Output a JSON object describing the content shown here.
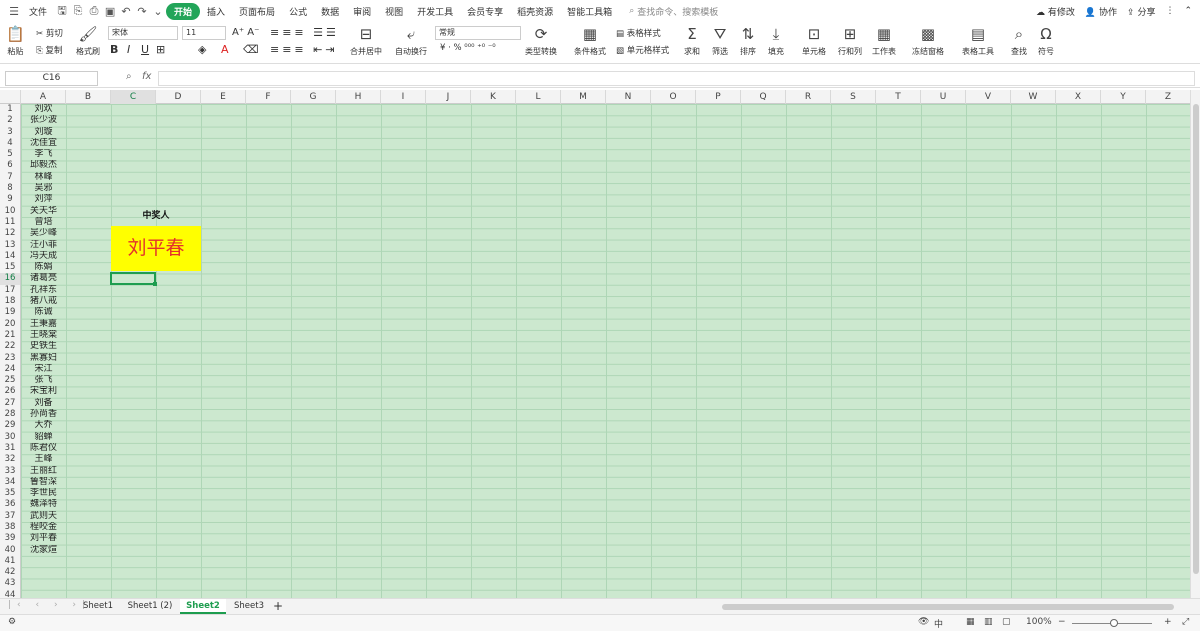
{
  "menubar": {
    "file": "文件",
    "tabs": [
      "开始",
      "插入",
      "页面布局",
      "公式",
      "数据",
      "审阅",
      "视图",
      "开发工具",
      "会员专享",
      "稻壳资源",
      "智能工具箱"
    ],
    "search_placeholder": "查找命令、搜索模板",
    "right": {
      "modified": "有修改",
      "collab": "协作",
      "share": "分享"
    }
  },
  "ribbon": {
    "paste": "粘贴",
    "cut": "剪切",
    "copy": "复制",
    "format_painter": "格式刷",
    "font_name": "宋体",
    "font_size": "11",
    "merge_center": "合并居中",
    "wrap_text": "自动换行",
    "number_format": "常规",
    "type_convert": "类型转换",
    "cond_format": "条件格式",
    "table_style": "表格样式",
    "cell_style": "单元格样式",
    "sum": "求和",
    "filter": "筛选",
    "sort": "排序",
    "fill": "填充",
    "cell": "单元格",
    "row_col": "行和列",
    "worksheet": "工作表",
    "freeze": "冻结窗格",
    "table_tools": "表格工具",
    "find": "查找",
    "symbol": "符号"
  },
  "formula_bar": {
    "cell_ref": "C16",
    "fx": "fx",
    "content": ""
  },
  "sheet": {
    "columns": [
      "A",
      "B",
      "C",
      "D",
      "E",
      "F",
      "G",
      "H",
      "I",
      "J",
      "K",
      "L",
      "M",
      "N",
      "O",
      "P",
      "Q",
      "R",
      "S",
      "T",
      "U",
      "V",
      "W",
      "X",
      "Y",
      "Z"
    ],
    "selected_col": "C",
    "selected_row": 16,
    "row_count": 44,
    "names": [
      "刘欢",
      "张少波",
      "刘璇",
      "沈佳宜",
      "李飞",
      "邱毅杰",
      "林峰",
      "吴邪",
      "刘萍",
      "关天华",
      "曾培",
      "吴少峰",
      "汪小菲",
      "冯天成",
      "陈娟",
      "诸葛亮",
      "孔祥东",
      "猪八戒",
      "陈诚",
      "王秉嘉",
      "王晓棠",
      "史铁生",
      "黑寡妇",
      "宋江",
      "张飞",
      "宋宝利",
      "刘备",
      "孙尚香",
      "大乔",
      "貂蝉",
      "陈君仪",
      "王峰",
      "王丽红",
      "鲁智深",
      "李世民",
      "魏泽特",
      "武则天",
      "程咬金",
      "刘平春",
      "沈家煊"
    ],
    "winner_label": "中奖人",
    "winner_name": "刘平春"
  },
  "tabs": {
    "items": [
      "Sheet1",
      "Sheet1 (2)",
      "Sheet2",
      "Sheet3"
    ],
    "active": "Sheet2",
    "add": "+"
  },
  "status": {
    "zoom": "100%",
    "minus": "−",
    "plus": "+"
  },
  "colors": {
    "accent": "#1e9d4f",
    "cell_bg": "#cce8cf",
    "winner_bg": "#ffff00",
    "winner_text": "#e4322b"
  }
}
